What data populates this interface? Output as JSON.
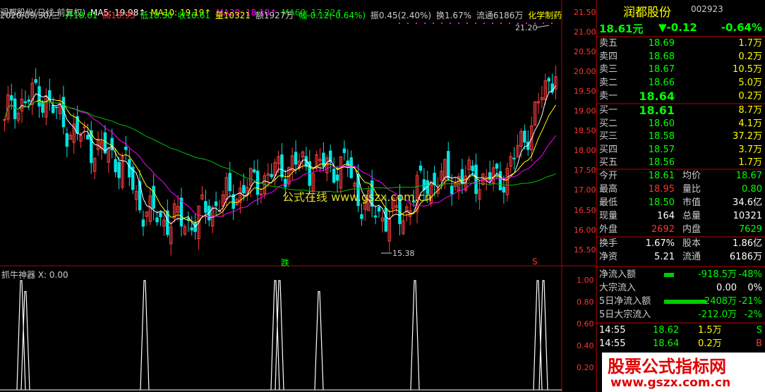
{
  "header": {
    "title": "润都股份(日线,前复权)",
    "ma5": "MA5: 19.98↑",
    "ma10": "MA10: 19.19↑",
    "ma20": "MA20: 18.10↑",
    "ma60": "MA60: 17.22↑",
    "date": "2020/09/30/三",
    "open": "开18.61",
    "high": "高18.95",
    "low": "低18.50",
    "close": "收18.61",
    "vol": "量10321",
    "amount": "额1927万",
    "change": "幅-0.12(-0.64%)",
    "amplitude": "振0.45(2.40%)",
    "turnover": "换1.67%",
    "float": "流通6186万",
    "sector": "化学制药"
  },
  "annotations": {
    "high_label": "21.20",
    "low_label": "15.38",
    "watermark_center": "公式在线 www.gszx.com.cn",
    "die_marker": "跌",
    "s_marker": "S"
  },
  "price_axis": [
    "21.50",
    "21.00",
    "20.50",
    "20.00",
    "19.50",
    "19.00",
    "18.50",
    "18.00",
    "17.50",
    "17.00",
    "16.50",
    "16.00",
    "15.50"
  ],
  "indicator": {
    "title": "抓牛神器 X: 0.00",
    "axis": [
      "1.00",
      "0.80",
      "0.60",
      "0.40",
      "0.20"
    ]
  },
  "quote": {
    "name": "润都股份",
    "code": "002923",
    "price": "18.61元",
    "change": "▼-0.12",
    "change_pct": "-0.64%",
    "sell": [
      {
        "label": "卖五",
        "price": "18.69",
        "vol": "1.7万"
      },
      {
        "label": "卖四",
        "price": "18.68",
        "vol": "0.2万"
      },
      {
        "label": "卖三",
        "price": "18.67",
        "vol": "10.5万"
      },
      {
        "label": "卖二",
        "price": "18.66",
        "vol": "5.0万"
      },
      {
        "label": "卖一",
        "price": "18.64",
        "vol": "0.2万"
      }
    ],
    "buy": [
      {
        "label": "买一",
        "price": "18.61",
        "vol": "8.7万"
      },
      {
        "label": "买二",
        "price": "18.60",
        "vol": "4.1万"
      },
      {
        "label": "买三",
        "price": "18.58",
        "vol": "37.2万"
      },
      {
        "label": "买四",
        "price": "18.57",
        "vol": "3.7万"
      },
      {
        "label": "买五",
        "price": "18.56",
        "vol": "1.7万"
      }
    ],
    "stats": [
      {
        "l1": "今开",
        "v1": "18.61",
        "l2": "均价",
        "v2": "18.67"
      },
      {
        "l1": "最高",
        "v1": "18.95",
        "l2": "量比",
        "v2": "0.80"
      },
      {
        "l1": "最低",
        "v1": "18.50",
        "l2": "市值",
        "v2": "34.6亿"
      },
      {
        "l1": "现量",
        "v1": "164",
        "l2": "总量",
        "v2": "10321"
      },
      {
        "l1": "外盘",
        "v1": "2692",
        "l2": "内盘",
        "v2": "7629"
      }
    ],
    "stats2": [
      {
        "l1": "换手",
        "v1": "1.67%",
        "l2": "股本",
        "v2": "1.86亿"
      },
      {
        "l1": "净资",
        "v1": "5.21",
        "l2": "流通",
        "v2": "6186万"
      }
    ],
    "flows": [
      {
        "label": "净流入额",
        "value": "-918.5万",
        "pct": "-48%"
      },
      {
        "label": "大宗流入",
        "value": "0.00",
        "pct": "0%"
      },
      {
        "label": "5日净流入额",
        "value": "-2408万",
        "pct": "-21%"
      },
      {
        "label": "5日大宗流入",
        "value": "-212.0万",
        "pct": "-2%"
      }
    ],
    "ticks": [
      {
        "time": "14:55",
        "price": "18.62",
        "vol": "1.5万",
        "side": "S"
      },
      {
        "time": "14:55",
        "price": "18.64",
        "vol": "0.2万",
        "side": "B"
      }
    ]
  },
  "watermark": {
    "line1": "股票公式指标网",
    "line2": "www.gszx.com.cn"
  },
  "colors": {
    "up": "#ff3c3c",
    "down": "#00e5e5",
    "yellow": "#ffff00",
    "green": "#00ff00",
    "purple": "#ff00ff",
    "ma5": "#ffffff",
    "ma10": "#ffff00",
    "ma20": "#ff00ff",
    "ma60": "#00c000"
  }
}
